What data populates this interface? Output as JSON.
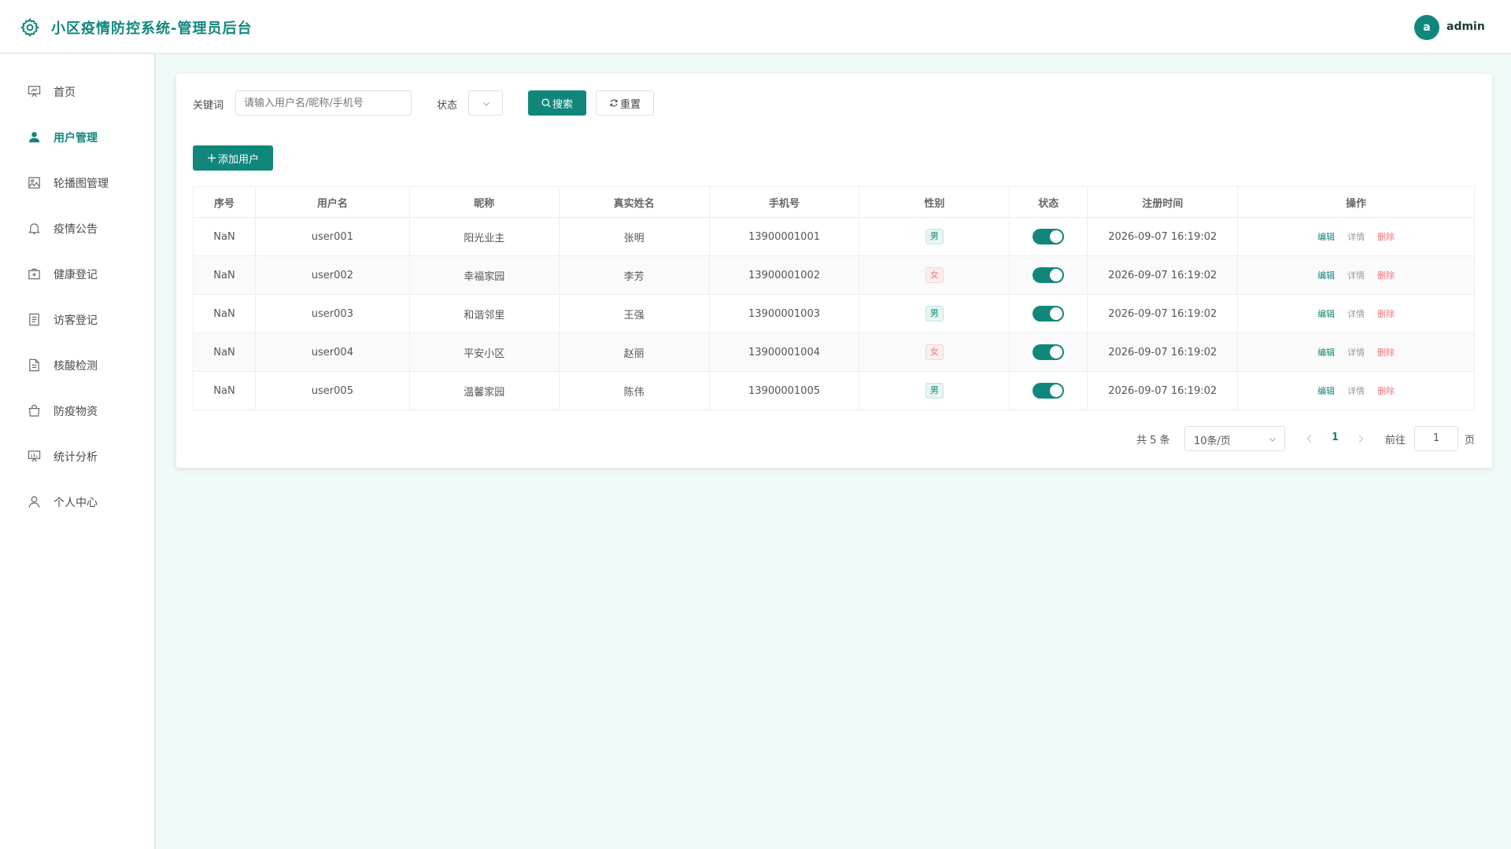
{
  "header": {
    "title": "小区疫情防控系统-管理员后台",
    "avatar_letter": "a",
    "username": "admin"
  },
  "sidebar": {
    "items": [
      {
        "label": "首页",
        "icon": "presentation-icon"
      },
      {
        "label": "用户管理",
        "icon": "user-icon"
      },
      {
        "label": "轮播图管理",
        "icon": "image-icon"
      },
      {
        "label": "疫情公告",
        "icon": "bell-icon"
      },
      {
        "label": "健康登记",
        "icon": "first-aid-icon"
      },
      {
        "label": "访客登记",
        "icon": "document-icon"
      },
      {
        "label": "核酸检测",
        "icon": "report-icon"
      },
      {
        "label": "防疫物资",
        "icon": "shopping-bag-icon"
      },
      {
        "label": "统计分析",
        "icon": "chart-board-icon"
      },
      {
        "label": "个人中心",
        "icon": "person-icon"
      }
    ],
    "active_index": 1
  },
  "search": {
    "keyword_label": "关键词",
    "keyword_placeholder": "请输入用户名/昵称/手机号",
    "status_label": "状态",
    "search_button": "搜索",
    "reset_button": "重置"
  },
  "toolbar": {
    "add_button": "添加用户"
  },
  "table": {
    "headers": [
      "序号",
      "用户名",
      "昵称",
      "真实姓名",
      "手机号",
      "性别",
      "状态",
      "注册时间",
      "操作"
    ],
    "actions": {
      "edit": "编辑",
      "detail": "详情",
      "delete": "删除"
    },
    "rows": [
      {
        "index": "NaN",
        "username": "user001",
        "nickname": "阳光业主",
        "realname": "张明",
        "phone": "13900001001",
        "gender": "男",
        "status_on": true,
        "registered": "2026-09-07 16:19:02"
      },
      {
        "index": "NaN",
        "username": "user002",
        "nickname": "幸福家园",
        "realname": "李芳",
        "phone": "13900001002",
        "gender": "女",
        "status_on": true,
        "registered": "2026-09-07 16:19:02"
      },
      {
        "index": "NaN",
        "username": "user003",
        "nickname": "和谐邻里",
        "realname": "王强",
        "phone": "13900001003",
        "gender": "男",
        "status_on": true,
        "registered": "2026-09-07 16:19:02"
      },
      {
        "index": "NaN",
        "username": "user004",
        "nickname": "平安小区",
        "realname": "赵丽",
        "phone": "13900001004",
        "gender": "女",
        "status_on": true,
        "registered": "2026-09-07 16:19:02"
      },
      {
        "index": "NaN",
        "username": "user005",
        "nickname": "温馨家园",
        "realname": "陈伟",
        "phone": "13900001005",
        "gender": "男",
        "status_on": true,
        "registered": "2026-09-07 16:19:02"
      }
    ]
  },
  "pagination": {
    "total_text": "共 5 条",
    "page_size": "10条/页",
    "current_page": "1",
    "goto_label": "前往",
    "goto_value": "1",
    "page_suffix": "页"
  },
  "colors": {
    "accent": "#11877c",
    "danger": "#f07575",
    "page_bg": "#f0faf8"
  }
}
